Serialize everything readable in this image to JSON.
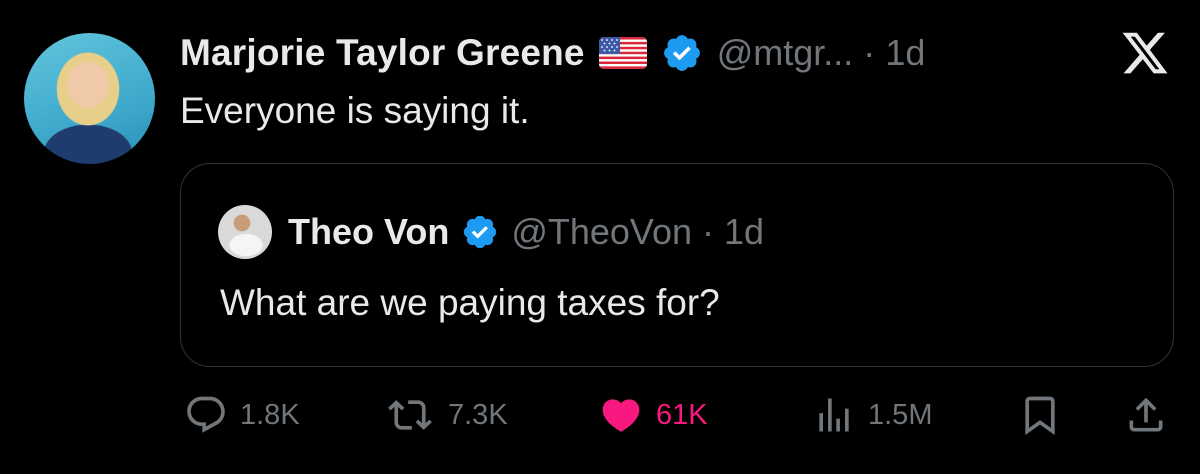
{
  "author": {
    "name": "Marjorie Taylor Greene",
    "handle": "@mtgr...",
    "time": "1d",
    "separator": "·",
    "flag_icon": "us-flag-icon",
    "verified_icon": "verified-badge-icon"
  },
  "tweet": {
    "text": "Everyone is saying it."
  },
  "quoted": {
    "name": "Theo Von",
    "handle": "@TheoVon",
    "separator": "·",
    "time": "1d",
    "text": "What are we paying taxes for?"
  },
  "actions": {
    "replies": "1.8K",
    "reposts": "7.3K",
    "likes": "61K",
    "views": "1.5M"
  },
  "colors": {
    "background": "#000000",
    "text": "#e7e9ea",
    "muted": "#71767b",
    "verified": "#1d9bf0",
    "like": "#f91880",
    "border": "#2f3336"
  }
}
